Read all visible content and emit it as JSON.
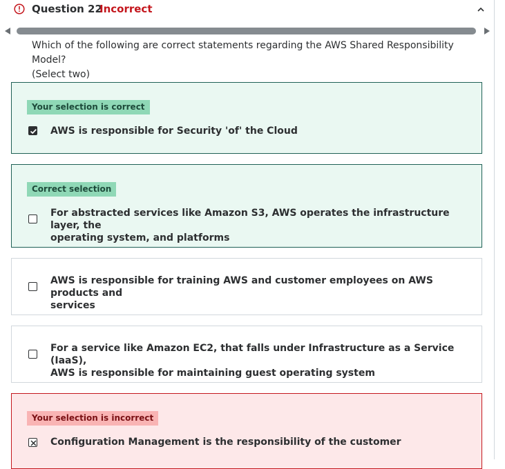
{
  "header": {
    "question_label": "Question 22",
    "status": "Incorrect",
    "status_color": "#c4161c",
    "alert_icon": "alert-circle-icon",
    "collapse_icon": "chevron-up-icon"
  },
  "question": {
    "text_line1": "Which of the following are correct statements regarding the AWS Shared Responsibility Model?",
    "text_line2": "(Select two)"
  },
  "options": [
    {
      "tag": "Your selection is correct",
      "text_line1": "AWS is responsible for Security 'of' the Cloud",
      "text_line2": "",
      "checked": true,
      "state": "correct-selected"
    },
    {
      "tag": "Correct selection",
      "text_line1": "For abstracted services like Amazon S3, AWS operates the infrastructure layer, the",
      "text_line2": "operating system, and platforms",
      "checked": false,
      "state": "correct-missed"
    },
    {
      "tag": "",
      "text_line1": "AWS is responsible for training AWS and customer employees on AWS products and",
      "text_line2": "services",
      "checked": false,
      "state": "neutral"
    },
    {
      "tag": "",
      "text_line1": "For a service like Amazon EC2, that falls under Infrastructure as a Service (IaaS),",
      "text_line2": "AWS is responsible for maintaining guest operating system",
      "checked": false,
      "state": "neutral"
    },
    {
      "tag": "Your selection is incorrect",
      "text_line1": "Configuration Management is the responsibility of the customer",
      "text_line2": "",
      "checked": true,
      "state": "incorrect-selected"
    }
  ],
  "colors": {
    "correct_bg": "#eaf8f2",
    "correct_border": "#1e6055",
    "incorrect_bg": "#fde8e9",
    "incorrect_border": "#c4161c",
    "tag_green": "#8fd8b6",
    "tag_red": "#f9b4b4"
  }
}
